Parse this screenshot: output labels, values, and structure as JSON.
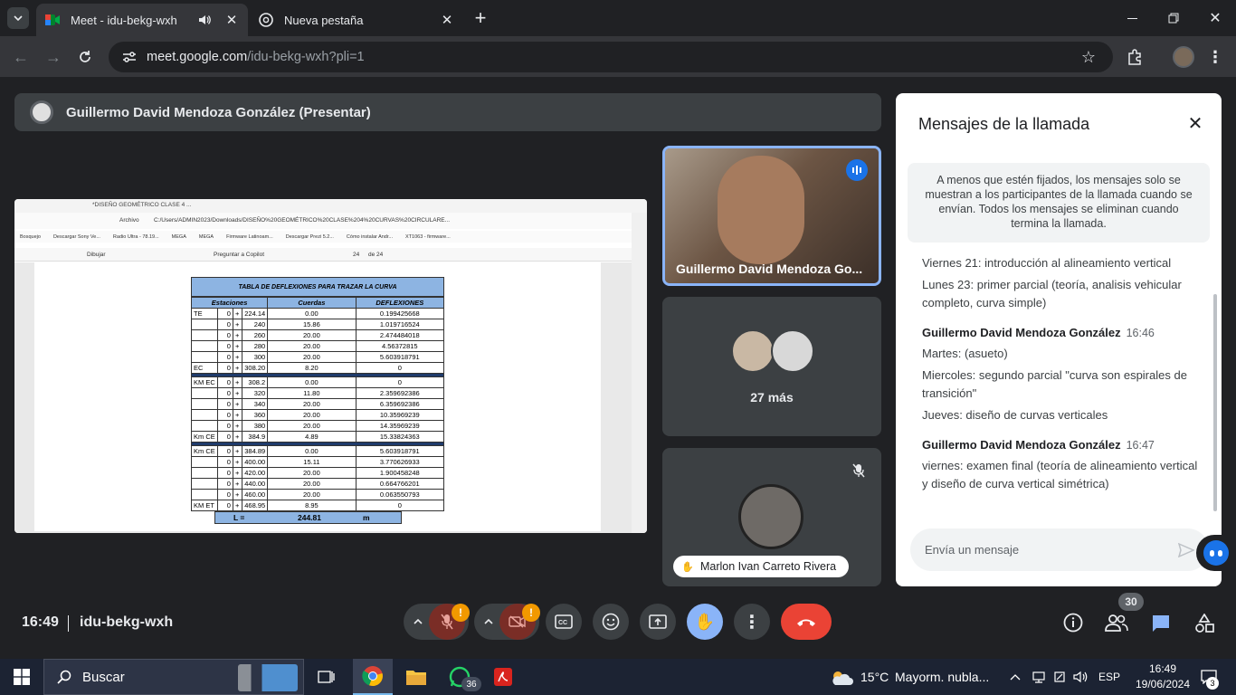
{
  "browser": {
    "tabs": [
      {
        "title": "Meet - idu-bekg-wxh",
        "active": true
      },
      {
        "title": "Nueva pestaña",
        "active": false
      }
    ],
    "url_domain": "meet.google.com",
    "url_path": "/idu-bekg-wxh?pli=1"
  },
  "meet": {
    "presenter_label": "Guillermo David Mendoza González (Presentar)",
    "shared_window": {
      "tab_title": "*DISEÑO GEOMÉTRICO CLASE 4 ...",
      "archivo_label": "Archivo",
      "path": "C:/Users/ADMIN2023/Downloads/DISEÑO%20GEOMÉTRICO%20CLASE%204%20CURVAS%20CIRCULARE...",
      "bookmarks": [
        "Bosquejo",
        "Descargar Sony Ve...",
        "Radio Ultra - 78.19...",
        "MEGA",
        "MEGA",
        "Firmware Latinoam...",
        "Descargar Prezi 5.2...",
        "Cómo instalar Andr...",
        "XT1063 - firmware..."
      ],
      "pdf_toolbar": {
        "draw": "Dibujar",
        "copilot": "Preguntar a Copilot",
        "page": "24",
        "of_pages": "de 24"
      },
      "table": {
        "title": "TABLA DE DEFLEXIONES PARA TRAZAR LA CURVA",
        "headers": [
          "Estaciones",
          "Cuerdas",
          "DEFLEXIONES"
        ],
        "rows": [
          [
            "TE",
            "0",
            "+",
            "224.14",
            "0.00",
            "0.199425668"
          ],
          [
            "",
            "0",
            "+",
            "240",
            "15.86",
            "1.019716524"
          ],
          [
            "",
            "0",
            "+",
            "260",
            "20.00",
            "2.474484018"
          ],
          [
            "",
            "0",
            "+",
            "280",
            "20.00",
            "4.56372815"
          ],
          [
            "",
            "0",
            "+",
            "300",
            "20.00",
            "5.603918791"
          ],
          [
            "EC",
            "0",
            "+",
            "308.20",
            "8.20",
            "0"
          ],
          [
            "sep"
          ],
          [
            "KM EC",
            "0",
            "+",
            "308.2",
            "0.00",
            "0"
          ],
          [
            "",
            "0",
            "+",
            "320",
            "11.80",
            "2.359692386"
          ],
          [
            "",
            "0",
            "+",
            "340",
            "20.00",
            "6.359692386"
          ],
          [
            "",
            "0",
            "+",
            "360",
            "20.00",
            "10.35969239"
          ],
          [
            "",
            "0",
            "+",
            "380",
            "20.00",
            "14.35969239"
          ],
          [
            "Km CE",
            "0",
            "+",
            "384.9",
            "4.89",
            "15.33824363"
          ],
          [
            "sep"
          ],
          [
            "Km CE",
            "0",
            "+",
            "384.89",
            "0.00",
            "5.603918791"
          ],
          [
            "",
            "0",
            "+",
            "400.00",
            "15.11",
            "3.770626933"
          ],
          [
            "",
            "0",
            "+",
            "420.00",
            "20.00",
            "1.900458248"
          ],
          [
            "",
            "0",
            "+",
            "440.00",
            "20.00",
            "0.664766201"
          ],
          [
            "",
            "0",
            "+",
            "460.00",
            "20.00",
            "0.063550793"
          ],
          [
            "KM ET",
            "0",
            "+",
            "468.95",
            "8.95",
            "0"
          ]
        ],
        "total_label": "L =",
        "total_value": "244.81",
        "total_unit": "m"
      }
    },
    "tiles": {
      "speaker_name": "Guillermo David Mendoza Go...",
      "others_count": "27 más",
      "participant_name": "Marlon Ivan Carreto Rivera"
    },
    "chat": {
      "title": "Mensajes de la llamada",
      "notice": "A menos que estén fijados, los mensajes solo se muestran a los participantes de la llamada cuando se envían. Todos los mensajes se eliminan cuando termina la llamada.",
      "leading": [
        "Viernes 21: introducción al alineamiento vertical",
        "Lunes 23: primer parcial (teoría, analisis vehicular completo, curva simple)"
      ],
      "groups": [
        {
          "author": "Guillermo David Mendoza González",
          "time": "16:46",
          "lines": [
            "Martes: (asueto)",
            "Miercoles: segundo parcial \"curva son espirales de transición\"",
            "Jueves: diseño de curvas verticales"
          ]
        },
        {
          "author": "Guillermo David Mendoza González",
          "time": "16:47",
          "lines": [
            "viernes: examen final (teoría de alineamiento vertical y diseño de curva vertical simétrica)"
          ]
        }
      ],
      "input_placeholder": "Envía un mensaje"
    },
    "bottom": {
      "time": "16:49",
      "meeting_code": "idu-bekg-wxh",
      "participants_badge": "30",
      "warning": "!"
    }
  },
  "taskbar": {
    "search_placeholder": "Buscar",
    "whatsapp_badge": "36",
    "weather_temp": "15°C",
    "weather_text": "Mayorm. nubla...",
    "lang": "ESP",
    "time": "16:49",
    "date": "19/06/2024",
    "notif_count": "3"
  },
  "colors": {
    "accent_blue": "#8ab4f8",
    "hangup_red": "#ea4335",
    "table_header_blue": "#8db4e2"
  }
}
